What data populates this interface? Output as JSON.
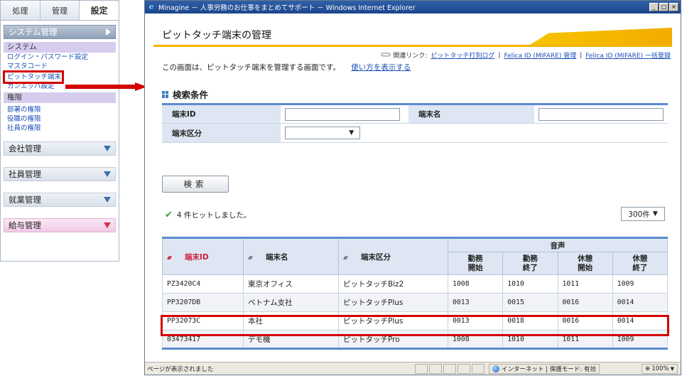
{
  "sidebar": {
    "tabs": [
      {
        "label": "処理"
      },
      {
        "label": "管理"
      },
      {
        "label": "設定"
      }
    ],
    "system_mgmt": "システム管理",
    "system_sub": "システム",
    "system_links": [
      "ログイン・パスワード設定",
      "マスタコード",
      "ピットタッチ端末",
      "カンエッパ設定"
    ],
    "auth_sub": "権限",
    "auth_links": [
      "部署の権限",
      "役職の権限",
      "社員の権限"
    ],
    "sections": [
      "会社管理",
      "社員管理",
      "就業管理",
      "給与管理"
    ]
  },
  "browser": {
    "title": "Minagine － 人事労務のお仕事をまとめてサポート － Windows Internet Explorer",
    "win_min": "_",
    "win_max": "□",
    "win_close": "×"
  },
  "page": {
    "title": "ピットタッチ端末の管理",
    "related_label": "関連リンク:",
    "related_links": [
      "ピットタッチ打刻ログ",
      "Felica ID (MIFARE) 管理",
      "Felica ID (MIFARE) 一括登録"
    ],
    "separator": "|",
    "intro": "この画面は、ピットタッチ端末を管理する画面です。",
    "howto_link": "使い方を表示する",
    "search_heading": "検索条件",
    "search": {
      "terminal_id_label": "端末ID",
      "terminal_name_label": "端末名",
      "terminal_type_label": "端末区分",
      "terminal_id_value": "",
      "terminal_name_value": "",
      "terminal_type_value": "",
      "dropdown_glyph": "▼"
    },
    "search_button": "検索",
    "hit_message": "4 件ヒットしました。",
    "per_page": "300件",
    "per_page_glyph": "▼"
  },
  "results": {
    "headers": {
      "terminal_id": "端末ID",
      "terminal_name": "端末名",
      "terminal_type": "端末区分",
      "voice": "音声",
      "work_start": [
        "勤務",
        "開始"
      ],
      "work_end": [
        "勤務",
        "終了"
      ],
      "break_start": [
        "休憩",
        "開始"
      ],
      "break_end": [
        "休憩",
        "終了"
      ]
    },
    "rows": [
      {
        "id": "PZ3420C4",
        "name": "東京オフィス",
        "type": "ピットタッチBiz2",
        "ws": "1008",
        "we": "1010",
        "bs": "1011",
        "be": "1009"
      },
      {
        "id": "PP3207DB",
        "name": "ベトナム支社",
        "type": "ピットタッチPlus",
        "ws": "0013",
        "we": "0015",
        "bs": "0016",
        "be": "0014"
      },
      {
        "id": "PP32073C",
        "name": "本社",
        "type": "ピットタッチPlus",
        "ws": "0013",
        "we": "0018",
        "bs": "0016",
        "be": "0014"
      },
      {
        "id": "03473417",
        "name": "デモ機",
        "type": "ピットタッチPro",
        "ws": "1008",
        "we": "1010",
        "bs": "1011",
        "be": "1009"
      }
    ]
  },
  "statusbar": {
    "text": "ページが表示されました",
    "zone": "インターネット | 保護モード: 有効",
    "zoom": "100%"
  },
  "colors": {
    "accent_blue": "#5b8ad0",
    "highlight_red": "#d40000",
    "title_gold": "#f0b500",
    "sort_red": "#d01d3b"
  }
}
